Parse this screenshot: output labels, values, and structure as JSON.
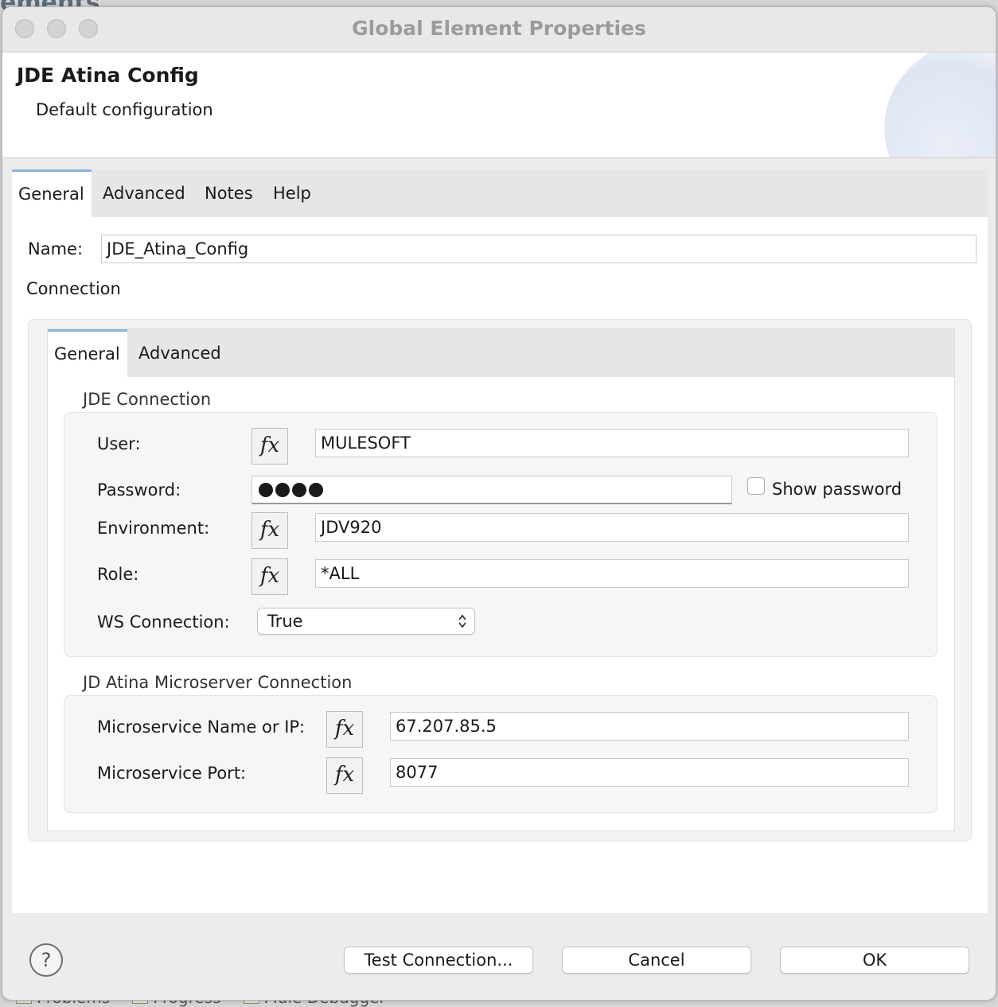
{
  "background": {
    "title_fragment": "ements",
    "bottom_tabs": [
      "Problems",
      "Progress",
      "Mule Debugger"
    ]
  },
  "window": {
    "title": "Global Element Properties"
  },
  "banner": {
    "title": "JDE Atina Config",
    "subtitle": "Default configuration"
  },
  "tabs": [
    "General",
    "Advanced",
    "Notes",
    "Help"
  ],
  "name_field": {
    "label": "Name:",
    "value": "JDE_Atina_Config"
  },
  "connection_label": "Connection",
  "connection_tabs": [
    "General",
    "Advanced"
  ],
  "jde_connection": {
    "title": "JDE Connection",
    "user": {
      "label": "User:",
      "value": "MULESOFT"
    },
    "password": {
      "label": "Password:",
      "masked": "●●●●",
      "show_password_label": "Show password",
      "show_password_checked": false
    },
    "environment": {
      "label": "Environment:",
      "value": "JDV920"
    },
    "role": {
      "label": "Role:",
      "value": "*ALL"
    },
    "ws_connection": {
      "label": "WS Connection:",
      "value": "True"
    }
  },
  "microserver": {
    "title": "JD Atina Microserver Connection",
    "name_or_ip": {
      "label": "Microservice Name or IP:",
      "value": "67.207.85.5"
    },
    "port": {
      "label": "Microservice Port:",
      "value": "8077"
    }
  },
  "fx_glyph": "fx",
  "footer": {
    "help_glyph": "?",
    "test_connection": "Test Connection...",
    "cancel": "Cancel",
    "ok": "OK"
  },
  "colors": {
    "active_tab_accent": "#8fb3d9",
    "dialog_bg": "#ececec",
    "title_text": "#9b9b9b"
  }
}
